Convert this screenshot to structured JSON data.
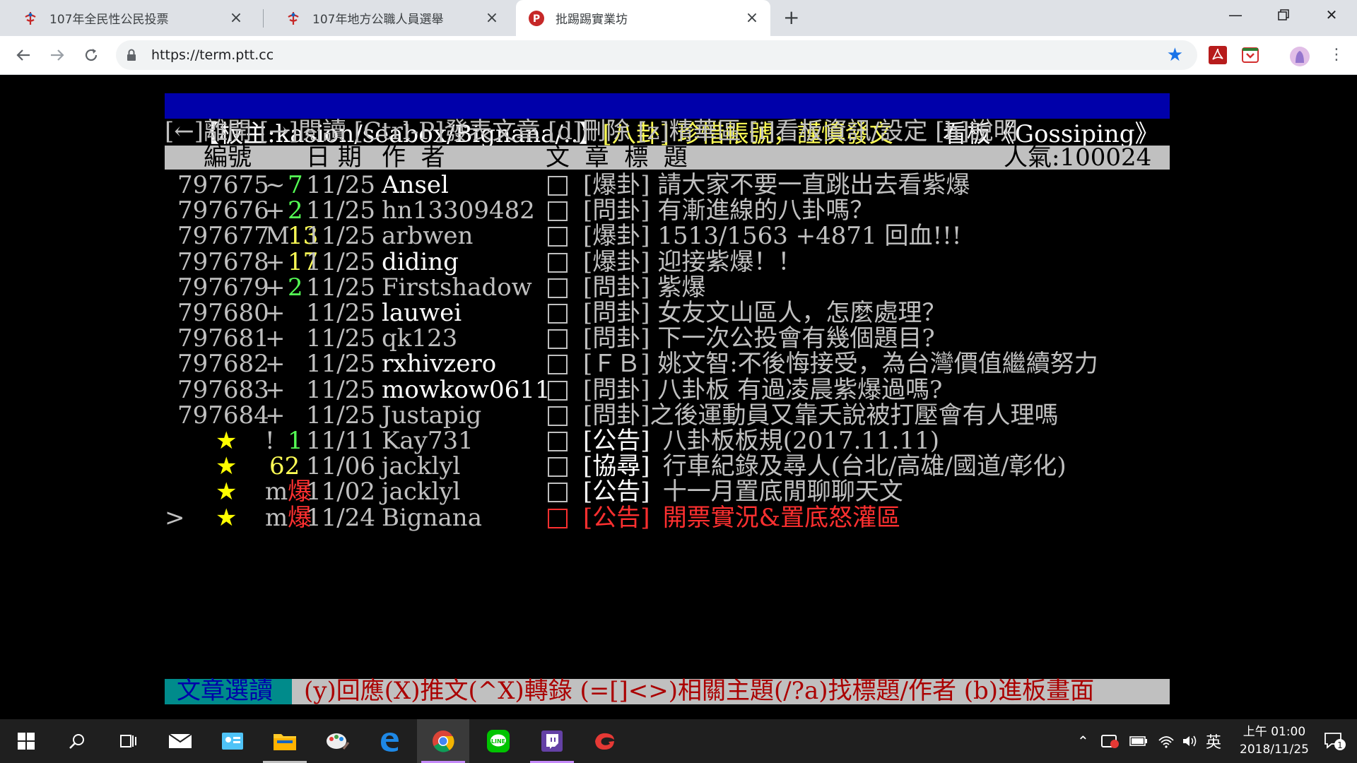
{
  "browser": {
    "tabs": [
      {
        "title": "107年全民性公民投票"
      },
      {
        "title": "107年地方公職人員選舉"
      },
      {
        "title": "批踢踢實業坊"
      }
    ],
    "url": "https://term.ptt.cc"
  },
  "terminal": {
    "header": {
      "moderators": "【板主:kasion/seabox/Bignana/..】",
      "notice": "[八卦] 珍惜帳號，謹慎發文",
      "board": "看板《Gossiping》"
    },
    "menu": "[←]離開 [→]閱讀 [Ctrl-P]發表文章 [d]刪除 [z]精華區 [i]看板資訊/設定 [h]說明",
    "columns": {
      "num": "編號",
      "date": "日 期",
      "author": "作  者",
      "title": "文  章  標  題",
      "popularity": "人氣:100024"
    },
    "rows": [
      {
        "num": "797675",
        "mark": "~",
        "recom": "7",
        "recom_color": "green",
        "date": "11/25",
        "author": "Ansel",
        "author_bright": true,
        "title": "[爆卦] 請大家不要一直跳出去看紫爆",
        "title_bright": false
      },
      {
        "num": "797676",
        "mark": "+",
        "recom": "2",
        "recom_color": "green",
        "date": "11/25",
        "author": "hn13309482",
        "author_bright": false,
        "title": "[問卦] 有漸進線的八卦嗎？",
        "title_bright": false
      },
      {
        "num": "797677",
        "mark": "M",
        "recom": "13",
        "recom_color": "yellow",
        "date": "11/25",
        "author": "arbwen",
        "author_bright": false,
        "title": "[爆卦] 1513/1563 +4871 回血!!!",
        "title_bright": false
      },
      {
        "num": "797678",
        "mark": "+",
        "recom": "17",
        "recom_color": "yellow",
        "date": "11/25",
        "author": "diding",
        "author_bright": true,
        "title": "[爆卦] 迎接紫爆！！",
        "title_bright": false
      },
      {
        "num": "797679",
        "mark": "+",
        "recom": "2",
        "recom_color": "green",
        "date": "11/25",
        "author": "Firstshadow",
        "author_bright": false,
        "title": "[問卦] 紫爆",
        "title_bright": false
      },
      {
        "num": "797680",
        "mark": "+",
        "recom": "",
        "recom_color": "none",
        "date": "11/25",
        "author": "lauwei",
        "author_bright": true,
        "title": "[問卦] 女友文山區人，怎麼處理？",
        "title_bright": false
      },
      {
        "num": "797681",
        "mark": "+",
        "recom": "",
        "recom_color": "none",
        "date": "11/25",
        "author": "qk123",
        "author_bright": false,
        "title": "[問卦] 下一次公投會有幾個題目?",
        "title_bright": false
      },
      {
        "num": "797682",
        "mark": "+",
        "recom": "",
        "recom_color": "none",
        "date": "11/25",
        "author": "rxhivzero",
        "author_bright": true,
        "title": "[ＦＢ] 姚文智:不後悔接受，為台灣價值繼續努力",
        "title_bright": false
      },
      {
        "num": "797683",
        "mark": "+",
        "recom": "",
        "recom_color": "none",
        "date": "11/25",
        "author": "mowkow0611",
        "author_bright": true,
        "title": "[問卦] 八卦板 有過凌晨紫爆過嗎?",
        "title_bright": false
      },
      {
        "num": "797684",
        "mark": "+",
        "recom": "",
        "recom_color": "none",
        "date": "11/25",
        "author": "Justapig",
        "author_bright": false,
        "title": "[問卦]之後運動員又靠夭說被打壓會有人理嗎",
        "title_bright": false
      }
    ],
    "pinned": [
      {
        "star": "★",
        "mark": "!",
        "recom": "1",
        "recom_color": "green",
        "date": "11/11",
        "author": "Kay731",
        "title_tag": "[公告]",
        "title_rest": " 八卦板板規(2017.11.11)",
        "cursor": ""
      },
      {
        "star": "★",
        "mark": "",
        "recom": "62",
        "recom_color": "yellow",
        "date": "11/06",
        "author": "jacklyl",
        "title_tag": "[協尋]",
        "title_rest": " 行車紀錄及尋人(台北/高雄/國道/彰化)",
        "cursor": ""
      },
      {
        "star": "★",
        "mark": "m",
        "recom": "爆",
        "recom_color": "red",
        "date": "11/02",
        "author": "jacklyl",
        "title_tag": "[公告]",
        "title_rest": " 十一月置底閒聊聊天文",
        "cursor": ""
      },
      {
        "star": "★",
        "mark": "m",
        "recom": "爆",
        "recom_color": "red",
        "date": "11/24",
        "author": "Bignana",
        "title_tag": "[公告]",
        "title_rest": " 開票實況&置底怒灌區",
        "cursor": ">"
      }
    ],
    "footer": {
      "mode": "文章選讀",
      "keys": "(y)回應(X)推文(^X)轉錄 (=[]<>)相關主題(/?a)找標題/作者 (b)進板畫面"
    }
  },
  "taskbar": {
    "ime": "英",
    "time": "上午 01:00",
    "date": "2018/11/25",
    "notifications": "1"
  }
}
